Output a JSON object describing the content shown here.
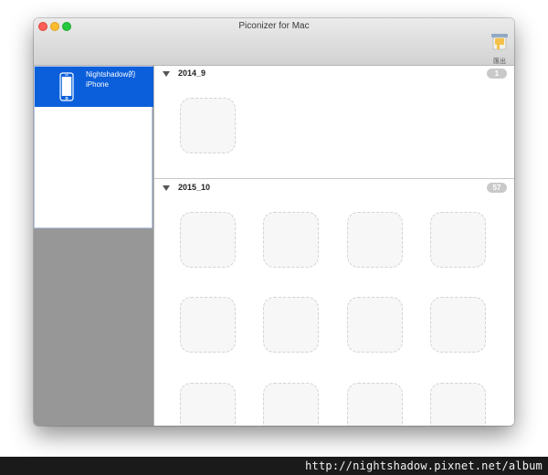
{
  "window": {
    "title": "Piconizer for Mac"
  },
  "toolbar": {
    "export_label": "匯出",
    "export_icon": "export-icon"
  },
  "sidebar": {
    "devices": [
      {
        "label": "Nightshadow的 iPhone",
        "icon": "iphone-icon",
        "selected": true
      }
    ]
  },
  "sections": [
    {
      "title": "2014_9",
      "count": "1",
      "expanded": true
    },
    {
      "title": "2015_10",
      "count": "57",
      "expanded": true
    }
  ],
  "watermark": {
    "text": "http://nightshadow.pixnet.net/album"
  },
  "colors": {
    "selection": "#0b5fdb",
    "sidebar_bg": "#979797",
    "badge": "#c9c9c9",
    "tile_border": "#d3d3d3"
  }
}
